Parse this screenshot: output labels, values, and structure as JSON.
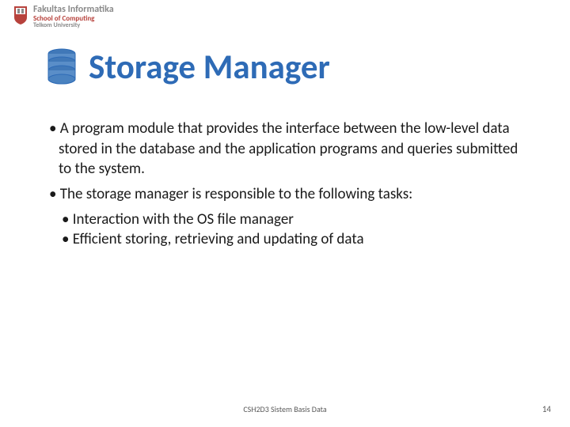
{
  "logo": {
    "line1": "Fakultas Informatika",
    "line2": "School of Computing",
    "line3": "Telkom University"
  },
  "title": "Storage Manager",
  "bullets": {
    "b1": "• A program module that provides the interface between the low-level data stored in the database and the application programs and queries submitted to the system.",
    "b2": "• The storage manager is responsible to the following tasks:",
    "b2a": "• Interaction with the OS file manager",
    "b2b": "• Efficient storing, retrieving and updating of data"
  },
  "footer": {
    "course": "CSH2D3 Sistem Basis Data",
    "page": "14"
  }
}
